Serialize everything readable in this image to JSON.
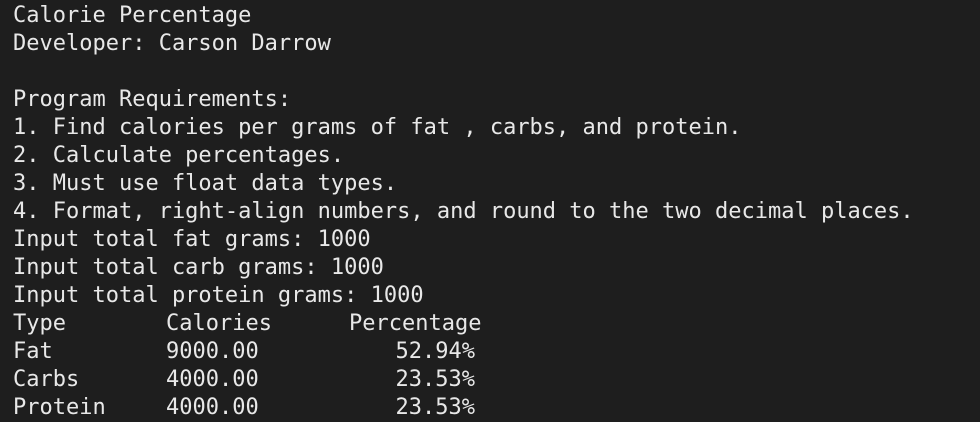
{
  "program": {
    "title": "Calorie Percentage",
    "developer": "Developer: Carson Darrow"
  },
  "requirements": {
    "heading": "Program Requirements:",
    "items": [
      "1. Find calories per grams of fat , carbs, and protein.",
      "2. Calculate percentages.",
      "3. Must use float data types.",
      "4. Format, right-align numbers, and round to the two decimal places."
    ]
  },
  "inputs": [
    "Input total fat grams: 1000",
    "Input total carb grams: 1000",
    "Input total protein grams: 1000"
  ],
  "table": {
    "headers": [
      "Type",
      "Calories",
      "Percentage"
    ],
    "rows": [
      {
        "type": "Fat",
        "calories": "9000.00",
        "percentage": "52.94%"
      },
      {
        "type": "Carbs",
        "calories": "4000.00",
        "percentage": "23.53%"
      },
      {
        "type": "Protein",
        "calories": "4000.00",
        "percentage": "23.53%"
      }
    ]
  },
  "colors": {
    "background": "#1e1e1e",
    "text": "#e8e8e8"
  }
}
